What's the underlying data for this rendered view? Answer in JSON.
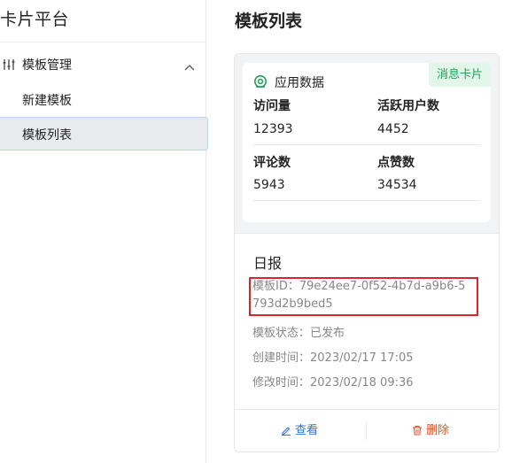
{
  "sidebar": {
    "app_title": "卡片平台",
    "group": {
      "label": "模板管理",
      "icon": "sliders-icon",
      "expanded": true
    },
    "items": [
      {
        "label": "新建模板",
        "active": false
      },
      {
        "label": "模板列表",
        "active": true
      }
    ]
  },
  "main": {
    "page_title": "模板列表",
    "card": {
      "badge": "消息卡片",
      "app_data_label": "应用数据",
      "stats": [
        {
          "label": "访问量",
          "value": "12393"
        },
        {
          "label": "活跃用户数",
          "value": "4452"
        },
        {
          "label": "评论数",
          "value": "5943"
        },
        {
          "label": "点赞数",
          "value": "34534"
        }
      ],
      "report_title": "日报",
      "template_id": "模板ID：79e24ee7-0f52-4b7d-a9b6-5793d2b9bed5",
      "status": "模板状态：已发布",
      "created": "创建时间：2023/02/17 17:05",
      "modified": "修改时间：2023/02/18 09:36",
      "view_label": "查看",
      "delete_label": "删除"
    }
  },
  "colors": {
    "badge_bg": "#e3f6ea",
    "badge_text": "#1f9e57",
    "view_link": "#2f6fd6",
    "delete_link": "#e2532d",
    "highlight": "#d9262c"
  }
}
